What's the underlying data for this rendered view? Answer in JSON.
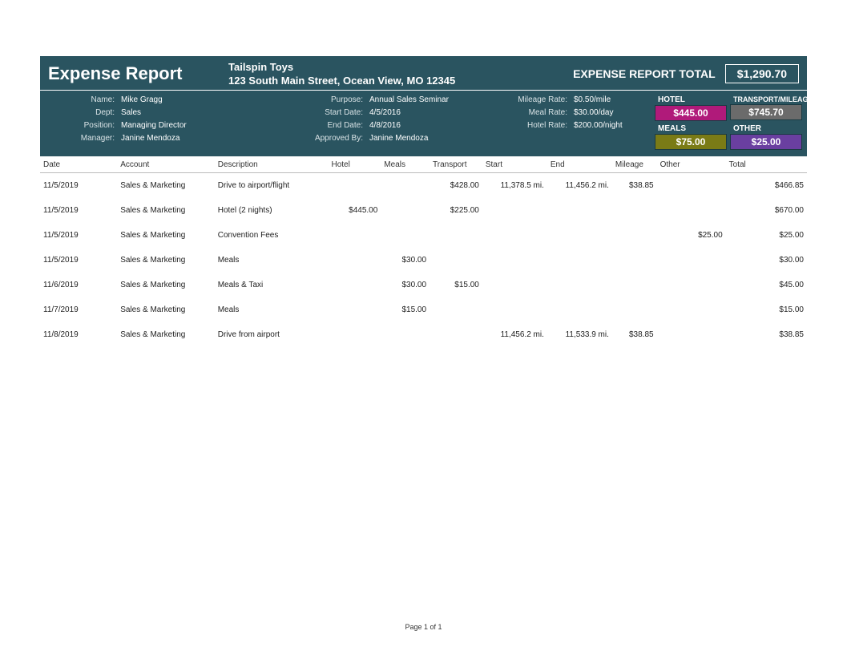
{
  "title": "Expense Report",
  "company": {
    "name": "Tailspin Toys",
    "address": "123 South Main Street, Ocean View, MO  12345"
  },
  "totalLabel": "EXPENSE REPORT TOTAL",
  "totalValue": "$1,290.70",
  "labels": {
    "name": "Name:",
    "dept": "Dept:",
    "position": "Position:",
    "manager": "Manager:",
    "purpose": "Purpose:",
    "startDate": "Start Date:",
    "endDate": "End Date:",
    "approvedBy": "Approved By:",
    "mileageRate": "Mileage Rate:",
    "mealRate": "Meal Rate:",
    "hotelRate": "Hotel Rate:"
  },
  "info": {
    "name": "Mike Gragg",
    "dept": "Sales",
    "position": "Managing Director",
    "manager": "Janine Mendoza",
    "purpose": "Annual Sales Seminar",
    "startDate": "4/5/2016",
    "endDate": "4/8/2016",
    "approvedBy": "Janine Mendoza",
    "mileageRate": "$0.50/mile",
    "mealRate": "$30.00/day",
    "hotelRate": "$200.00/night"
  },
  "summary": {
    "hotelLabel": "HOTEL",
    "hotelVal": "$445.00",
    "transportLabel": "TRANSPORT/MILEAGE",
    "transportVal": "$745.70",
    "mealsLabel": "MEALS",
    "mealsVal": "$75.00",
    "otherLabel": "OTHER",
    "otherVal": "$25.00"
  },
  "columns": {
    "date": "Date",
    "account": "Account",
    "description": "Description",
    "hotel": "Hotel",
    "meals": "Meals",
    "transport": "Transport",
    "start": "Start",
    "end": "End",
    "mileage": "Mileage",
    "other": "Other",
    "total": "Total"
  },
  "rows": [
    {
      "date": "11/5/2019",
      "account": "Sales & Marketing",
      "description": "Drive to airport/flight",
      "hotel": "",
      "meals": "",
      "transport": "$428.00",
      "start": "11,378.5 mi.",
      "end": "11,456.2 mi.",
      "mileage": "$38.85",
      "other": "",
      "total": "$466.85"
    },
    {
      "date": "11/5/2019",
      "account": "Sales & Marketing",
      "description": "Hotel (2 nights)",
      "hotel": "$445.00",
      "meals": "",
      "transport": "$225.00",
      "start": "",
      "end": "",
      "mileage": "",
      "other": "",
      "total": "$670.00"
    },
    {
      "date": "11/5/2019",
      "account": "Sales & Marketing",
      "description": "Convention Fees",
      "hotel": "",
      "meals": "",
      "transport": "",
      "start": "",
      "end": "",
      "mileage": "",
      "other": "$25.00",
      "total": "$25.00"
    },
    {
      "date": "11/5/2019",
      "account": "Sales & Marketing",
      "description": "Meals",
      "hotel": "",
      "meals": "$30.00",
      "transport": "",
      "start": "",
      "end": "",
      "mileage": "",
      "other": "",
      "total": "$30.00"
    },
    {
      "date": "11/6/2019",
      "account": "Sales & Marketing",
      "description": "Meals & Taxi",
      "hotel": "",
      "meals": "$30.00",
      "transport": "$15.00",
      "start": "",
      "end": "",
      "mileage": "",
      "other": "",
      "total": "$45.00"
    },
    {
      "date": "11/7/2019",
      "account": "Sales & Marketing",
      "description": "Meals",
      "hotel": "",
      "meals": "$15.00",
      "transport": "",
      "start": "",
      "end": "",
      "mileage": "",
      "other": "",
      "total": "$15.00"
    },
    {
      "date": "11/8/2019",
      "account": "Sales & Marketing",
      "description": "Drive from airport",
      "hotel": "",
      "meals": "",
      "transport": "",
      "start": "11,456.2 mi.",
      "end": "11,533.9 mi.",
      "mileage": "$38.85",
      "other": "",
      "total": "$38.85"
    }
  ],
  "footer": "Page 1 of 1"
}
